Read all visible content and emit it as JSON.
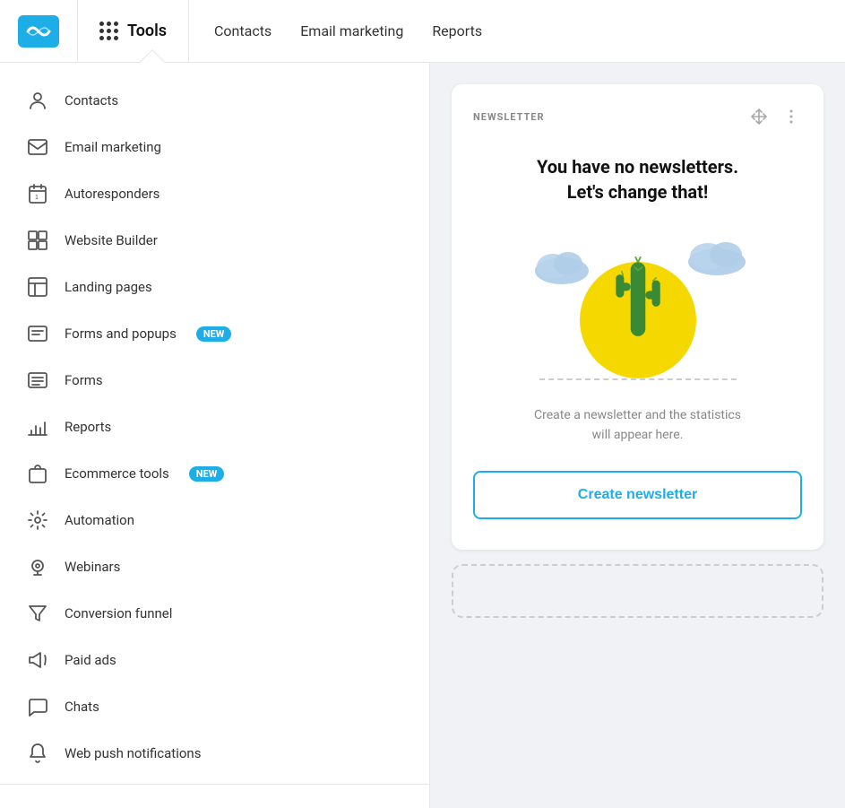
{
  "topbar": {
    "logo_alt": "GetResponse logo",
    "tools_label": "Tools",
    "nav_items": [
      {
        "id": "contacts",
        "label": "Contacts"
      },
      {
        "id": "email-marketing",
        "label": "Email marketing"
      },
      {
        "id": "reports",
        "label": "Reports"
      }
    ]
  },
  "sidebar": {
    "items": [
      {
        "id": "contacts",
        "label": "Contacts",
        "icon": "person-icon",
        "badge": null
      },
      {
        "id": "email-marketing",
        "label": "Email marketing",
        "icon": "envelope-icon",
        "badge": null
      },
      {
        "id": "autoresponders",
        "label": "Autoresponders",
        "icon": "calendar-icon",
        "badge": null
      },
      {
        "id": "website-builder",
        "label": "Website Builder",
        "icon": "grid-icon",
        "badge": null
      },
      {
        "id": "landing-pages",
        "label": "Landing pages",
        "icon": "layout-icon",
        "badge": null
      },
      {
        "id": "forms-popups",
        "label": "Forms and popups",
        "icon": "form-icon",
        "badge": "NEW"
      },
      {
        "id": "forms",
        "label": "Forms",
        "icon": "list-icon",
        "badge": null
      },
      {
        "id": "reports",
        "label": "Reports",
        "icon": "chart-icon",
        "badge": null
      },
      {
        "id": "ecommerce",
        "label": "Ecommerce tools",
        "icon": "bag-icon",
        "badge": "NEW"
      },
      {
        "id": "automation",
        "label": "Automation",
        "icon": "gear-icon",
        "badge": null
      },
      {
        "id": "webinars",
        "label": "Webinars",
        "icon": "webcam-icon",
        "badge": null
      },
      {
        "id": "conversion-funnel",
        "label": "Conversion funnel",
        "icon": "funnel-icon",
        "badge": null
      },
      {
        "id": "paid-ads",
        "label": "Paid ads",
        "icon": "megaphone-icon",
        "badge": null
      },
      {
        "id": "chats",
        "label": "Chats",
        "icon": "chat-icon",
        "badge": null
      },
      {
        "id": "web-push",
        "label": "Web push notifications",
        "icon": "bell-icon",
        "badge": null
      }
    ]
  },
  "newsletter_card": {
    "title": "NEWSLETTER",
    "empty_title": "You have no newsletters.\nLet's change that!",
    "description": "Create a newsletter and the statistics\nwill appear here.",
    "create_button_label": "Create newsletter",
    "move_icon": "move-icon",
    "menu_icon": "more-menu-icon"
  },
  "colors": {
    "accent": "#1daee8",
    "badge_bg": "#1daee8",
    "sun": "#f5d800",
    "cactus": "#3a8a35",
    "cloud": "#a8c8e8"
  }
}
